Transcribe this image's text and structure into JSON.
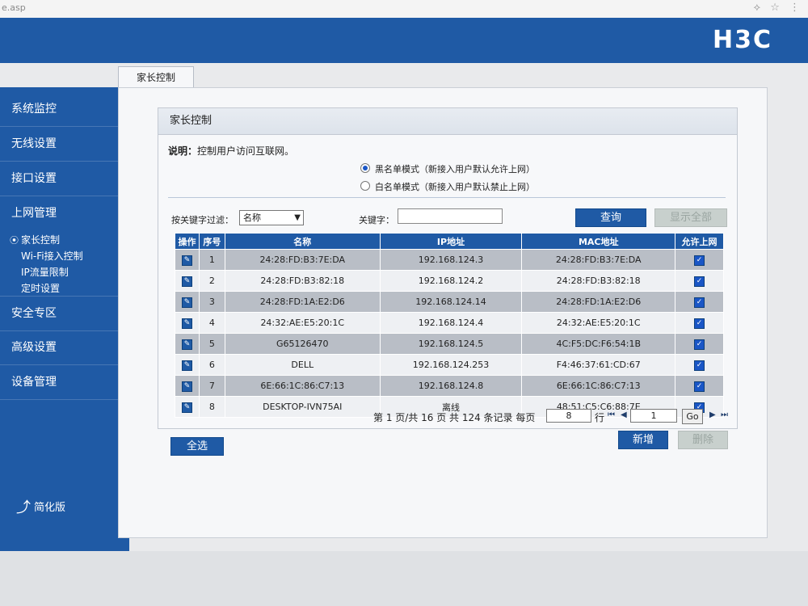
{
  "browser": {
    "url_fragment": "e.asp",
    "icons": "⟡ ☆ ⋮"
  },
  "header": {
    "logo": "H3C"
  },
  "sidebar": {
    "items": [
      {
        "label": "系统监控"
      },
      {
        "label": "无线设置"
      },
      {
        "label": "接口设置"
      },
      {
        "label": "上网管理"
      },
      {
        "label": "安全专区"
      },
      {
        "label": "高级设置"
      },
      {
        "label": "设备管理"
      }
    ],
    "sub_items": [
      {
        "label": "家长控制",
        "active": true
      },
      {
        "label": "Wi-Fi接入控制"
      },
      {
        "label": "IP流量限制"
      },
      {
        "label": "定时设置"
      }
    ],
    "simple_mode": "简化版"
  },
  "tab": {
    "label": "家长控制"
  },
  "panel": {
    "title": "家长控制",
    "desc_label": "说明：",
    "desc_text": "控制用户访问互联网。",
    "mode_blacklist": "黑名单模式（新接入用户默认允许上网）",
    "mode_whitelist": "白名单模式（新接入用户默认禁止上网）",
    "selected_mode": "blacklist"
  },
  "filter": {
    "label": "按关键字过滤：",
    "field_value": "名称",
    "keyword_label": "关键字：",
    "keyword_value": "",
    "query_button": "查询",
    "show_all_button": "显示全部"
  },
  "table": {
    "headers": [
      "操作",
      "序号",
      "名称",
      "IP地址",
      "MAC地址",
      "允许上网"
    ],
    "rows": [
      {
        "no": "1",
        "name": "24:28:FD:B3:7E:DA",
        "ip": "192.168.124.3",
        "mac": "24:28:FD:B3:7E:DA",
        "allowed": true
      },
      {
        "no": "2",
        "name": "24:28:FD:B3:82:18",
        "ip": "192.168.124.2",
        "mac": "24:28:FD:B3:82:18",
        "allowed": true
      },
      {
        "no": "3",
        "name": "24:28:FD:1A:E2:D6",
        "ip": "192.168.124.14",
        "mac": "24:28:FD:1A:E2:D6",
        "allowed": true
      },
      {
        "no": "4",
        "name": "24:32:AE:E5:20:1C",
        "ip": "192.168.124.4",
        "mac": "24:32:AE:E5:20:1C",
        "allowed": true
      },
      {
        "no": "5",
        "name": "G65126470",
        "ip": "192.168.124.5",
        "mac": "4C:F5:DC:F6:54:1B",
        "allowed": true
      },
      {
        "no": "6",
        "name": "DELL",
        "ip": "192.168.124.253",
        "mac": "F4:46:37:61:CD:67",
        "allowed": true
      },
      {
        "no": "7",
        "name": "6E:66:1C:86:C7:13",
        "ip": "192.168.124.8",
        "mac": "6E:66:1C:86:C7:13",
        "allowed": true
      },
      {
        "no": "8",
        "name": "DESKTOP-IVN75AI",
        "ip": "离线",
        "mac": "48:51:C5:C6:88:7E",
        "allowed": true
      }
    ]
  },
  "pager": {
    "summary": "第 1 页/共 16 页 共 124 条记录 每页",
    "per_page": "8",
    "rows_label": "行",
    "page_input": "1",
    "go": "Go"
  },
  "actions": {
    "select_all": "全选",
    "add": "新增",
    "delete": "删除"
  }
}
